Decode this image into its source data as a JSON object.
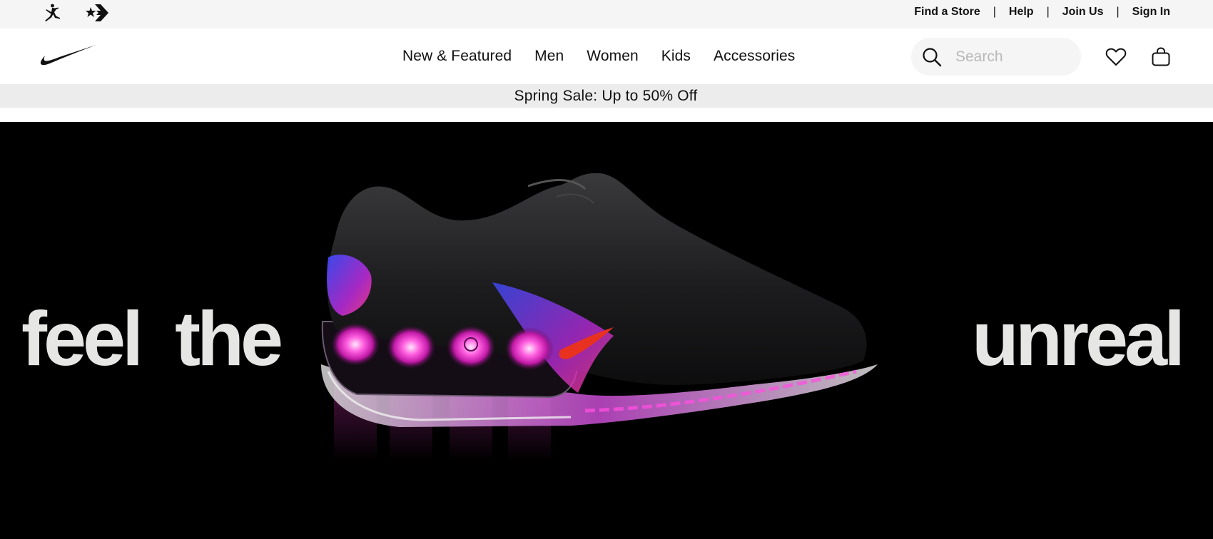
{
  "utility_bar": {
    "brand_icons": [
      "jordan-jumpman-icon",
      "converse-star-chevron-icon"
    ],
    "links": [
      {
        "label": "Find a Store"
      },
      {
        "label": "Help"
      },
      {
        "label": "Join Us"
      },
      {
        "label": "Sign In"
      }
    ],
    "separator": "|"
  },
  "header": {
    "logo": "nike-swoosh-icon",
    "nav": [
      {
        "label": "New & Featured"
      },
      {
        "label": "Men"
      },
      {
        "label": "Women"
      },
      {
        "label": "Kids"
      },
      {
        "label": "Accessories"
      }
    ],
    "search": {
      "placeholder": "Search",
      "value": ""
    },
    "icons": [
      "search-icon",
      "heart-icon",
      "bag-icon"
    ]
  },
  "promo": {
    "text": "Spring Sale: Up to 50% Off"
  },
  "hero": {
    "left_text": "feel the",
    "right_text": "unreal",
    "image": "black sneaker with glowing pink air units",
    "colors": {
      "background": "#000000",
      "headline": "#e6e6e4",
      "glow": "#ff3dd6"
    }
  },
  "colors": {
    "utility_bg": "#f5f5f5",
    "header_bg": "#ffffff",
    "promo_bg": "#ececec",
    "text": "#111111"
  }
}
